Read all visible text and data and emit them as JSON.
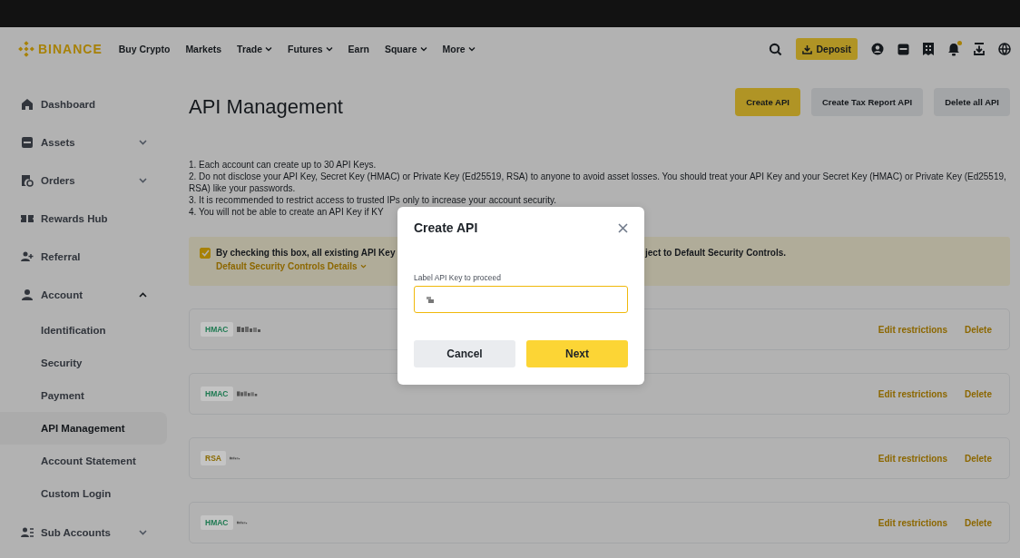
{
  "top_nav": {
    "logo": "BINANCE",
    "links": [
      {
        "label": "Buy Crypto",
        "dropdown": false
      },
      {
        "label": "Markets",
        "dropdown": false
      },
      {
        "label": "Trade",
        "dropdown": true
      },
      {
        "label": "Futures",
        "dropdown": true
      },
      {
        "label": "Earn",
        "dropdown": false
      },
      {
        "label": "Square",
        "dropdown": true
      },
      {
        "label": "More",
        "dropdown": true
      }
    ],
    "deposit": "Deposit",
    "notification_dot": true
  },
  "sidebar": {
    "items": [
      {
        "label": "Dashboard",
        "selected": false
      },
      {
        "label": "Assets",
        "selected": false,
        "expanded": false
      },
      {
        "label": "Orders",
        "selected": false,
        "expanded": false
      },
      {
        "label": "Rewards Hub",
        "selected": false
      },
      {
        "label": "Referral",
        "selected": false
      },
      {
        "label": "Account",
        "selected": false,
        "expanded": true,
        "children": [
          {
            "label": "Identification",
            "selected": false
          },
          {
            "label": "Security",
            "selected": false
          },
          {
            "label": "Payment",
            "selected": false
          },
          {
            "label": "API Management",
            "selected": true
          },
          {
            "label": "Account Statement",
            "selected": false
          },
          {
            "label": "Custom Login",
            "selected": false
          }
        ]
      },
      {
        "label": "Sub Accounts",
        "selected": false,
        "expanded": false
      }
    ]
  },
  "main": {
    "title": "API Management",
    "buttons": [
      {
        "label": "Create API",
        "kind": "primary"
      },
      {
        "label": "Create Tax Report API",
        "kind": "secondary"
      },
      {
        "label": "Delete all API",
        "kind": "secondary"
      }
    ],
    "notes": [
      "1. Each account can create up to 30 API Keys.",
      "2. Do not disclose your API Key, Secret Key (HMAC) or Private Key (Ed25519, RSA) to anyone to avoid asset losses. You should treat your API Key and your Secret Key (HMAC) or Private Key (Ed25519, RSA) like your passwords.",
      "3. It is recommended to restrict access to trusted IPs only to increase your account security.",
      "4. You will not be able to create an API Key if KY"
    ],
    "consent": {
      "checked": true,
      "text_left": "By checking this box, all existing API Key",
      "text_right": "ject to Default Security Controls.",
      "details_link": "Default Security Controls Details"
    },
    "api_keys": [
      {
        "type": "HMAC",
        "color": "#1f7a52",
        "actions": [
          "Edit restrictions",
          "Delete"
        ]
      },
      {
        "type": "HMAC",
        "color": "#1f7a52",
        "actions": [
          "Edit restrictions",
          "Delete"
        ]
      },
      {
        "type": "RSA",
        "color": "#8a6a00",
        "actions": [
          "Edit restrictions",
          "Delete"
        ]
      },
      {
        "type": "HMAC",
        "color": "#1f7a52",
        "actions": [
          "Edit restrictions",
          "Delete"
        ]
      }
    ]
  },
  "modal": {
    "title": "Create API",
    "field_label": "Label API Key to proceed",
    "buttons": [
      {
        "label": "Cancel",
        "kind": "secondary"
      },
      {
        "label": "Next",
        "kind": "primary"
      }
    ]
  }
}
